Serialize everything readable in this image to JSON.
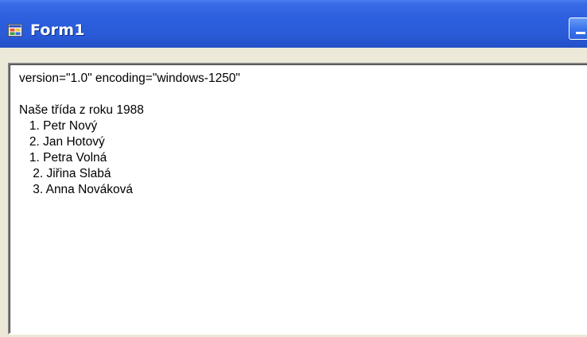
{
  "window": {
    "title": "Form1",
    "icon": "form-app-icon"
  },
  "textbox": {
    "lines": [
      "version=\"1.0\" encoding=\"windows-1250\"",
      "",
      "Naše třída z roku 1988",
      "   1. Petr Nový",
      "   2. Jan Hotový",
      "   1. Petra Volná",
      "    2. Jiřina Slabá",
      "    3. Anna Nováková"
    ]
  },
  "colors": {
    "titlebar": "#2c5fde",
    "client_background": "#ece9d8",
    "textbox_background": "#ffffff",
    "text": "#000000"
  }
}
